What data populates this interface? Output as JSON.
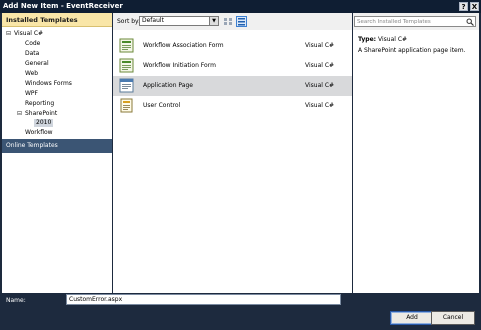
{
  "window": {
    "title": "Add New Item - EventReceiver",
    "help_label": "?",
    "close_label": "X"
  },
  "left": {
    "header": "Installed Templates",
    "tree": [
      {
        "label": "Visual C#",
        "expander": "⊟"
      },
      {
        "label": "Code"
      },
      {
        "label": "Data"
      },
      {
        "label": "General"
      },
      {
        "label": "Web"
      },
      {
        "label": "Windows Forms"
      },
      {
        "label": "WPF"
      },
      {
        "label": "Reporting"
      },
      {
        "label": "SharePoint",
        "expander": "⊟"
      },
      {
        "label": "2010"
      },
      {
        "label": "Workflow"
      }
    ],
    "online": "Online Templates"
  },
  "middle": {
    "sort_label": "Sort by:",
    "sort_value": "Default",
    "items": [
      {
        "name": "Workflow Association Form",
        "type": "Visual C#",
        "icon": "form-template-icon"
      },
      {
        "name": "Workflow Initiation Form",
        "type": "Visual C#",
        "icon": "form-template-icon"
      },
      {
        "name": "Application Page",
        "type": "Visual C#",
        "icon": "application-page-icon",
        "selected": true
      },
      {
        "name": "User Control",
        "type": "Visual C#",
        "icon": "user-control-icon"
      }
    ]
  },
  "right": {
    "search_placeholder": "Search Installed Templates",
    "type_label": "Type:",
    "type_value": "Visual C#",
    "description": "A SharePoint application page item."
  },
  "bottom": {
    "name_label": "Name:",
    "name_value": "CustomError.aspx",
    "add_label": "Add",
    "cancel_label": "Cancel"
  }
}
